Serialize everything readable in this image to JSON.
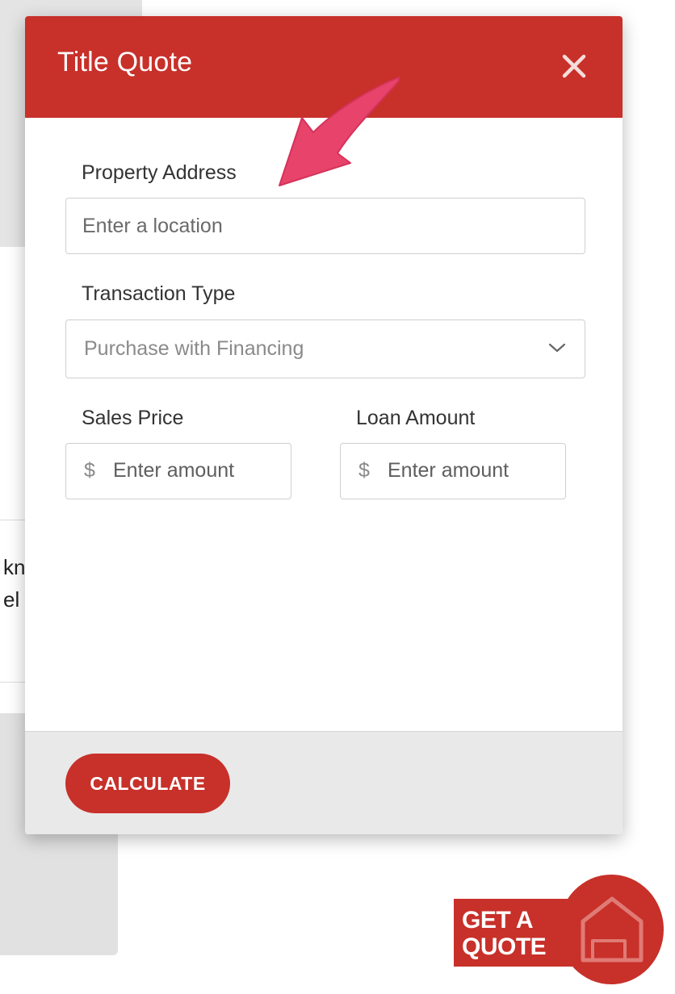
{
  "modal": {
    "title": "Title Quote",
    "close_icon": "close-icon"
  },
  "form": {
    "property_address": {
      "label": "Property Address",
      "placeholder": "Enter a location"
    },
    "transaction_type": {
      "label": "Transaction Type",
      "selected": "Purchase with Financing"
    },
    "sales_price": {
      "label": "Sales Price",
      "prefix": "$",
      "placeholder": "Enter amount"
    },
    "loan_amount": {
      "label": "Loan Amount",
      "prefix": "$",
      "placeholder": "Enter amount"
    }
  },
  "footer": {
    "calculate_label": "CALCULATE"
  },
  "widget": {
    "line1": "GET A",
    "line2": "QUOTE",
    "icon": "house-icon"
  },
  "background": {
    "fragment1": "kn",
    "fragment2": "el"
  },
  "colors": {
    "brand_red": "#c8302a",
    "annotation_pink": "#e8436a"
  }
}
